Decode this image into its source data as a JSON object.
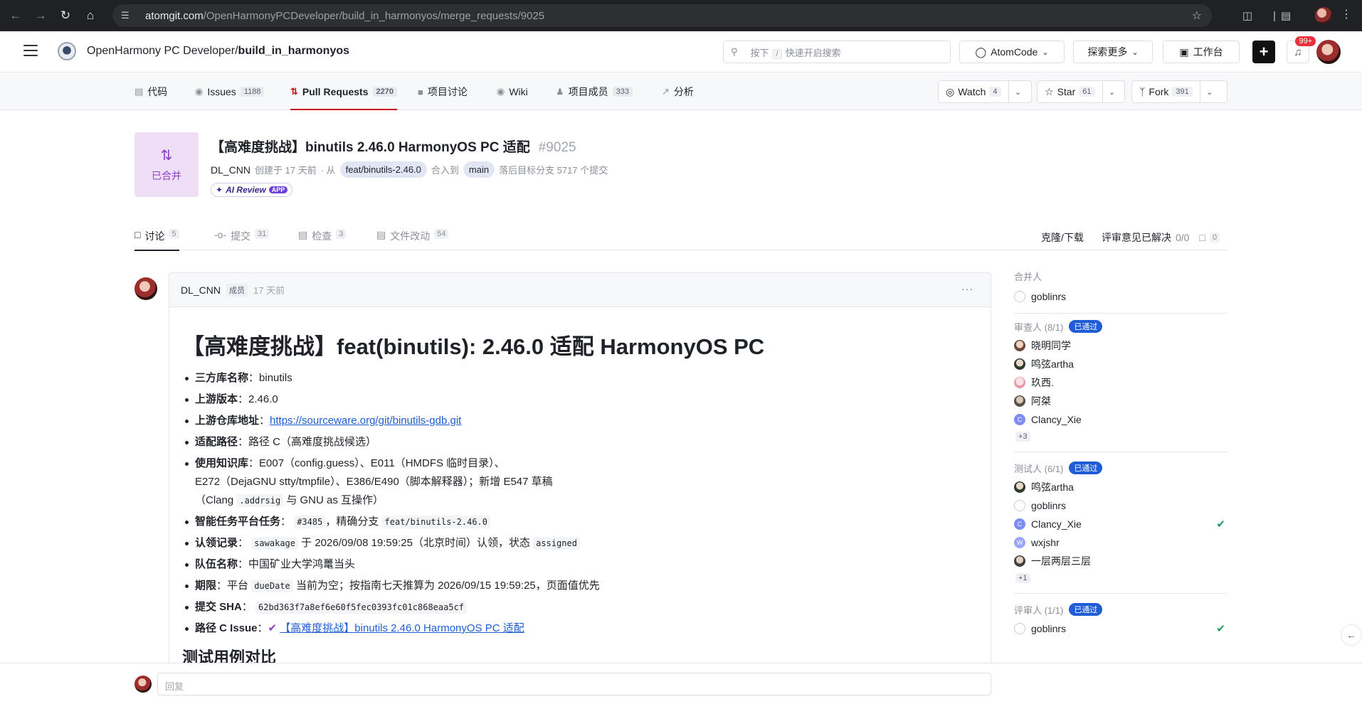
{
  "browser": {
    "url_host": "atomgit.com",
    "url_path": "/OpenHarmonyPCDeveloper/build_in_harmonyos/merge_requests/9025"
  },
  "header": {
    "breadcrumb_org": "OpenHarmony PC Developer/",
    "breadcrumb_repo": "build_in_harmonyos",
    "search_prefix": "按下",
    "search_key": "/",
    "search_suffix": "快速开启搜索",
    "atomcode_label": "AtomCode",
    "explore_label": "探索更多",
    "workbench_label": "工作台",
    "notif_badge": "99+"
  },
  "projnav": {
    "items": [
      {
        "label": "代码",
        "count": ""
      },
      {
        "label": "Issues",
        "count": "1188"
      },
      {
        "label": "Pull Requests",
        "count": "2270"
      },
      {
        "label": "项目讨论",
        "count": ""
      },
      {
        "label": "Wiki",
        "count": ""
      },
      {
        "label": "项目成员",
        "count": "333"
      },
      {
        "label": "分析",
        "count": ""
      }
    ],
    "watch": {
      "label": "Watch",
      "count": "4"
    },
    "star": {
      "label": "Star",
      "count": "61"
    },
    "fork": {
      "label": "Fork",
      "count": "391"
    }
  },
  "mr": {
    "state": "已合并",
    "title": "【高难度挑战】binutils 2.46.0 HarmonyOS PC 适配",
    "number": "#9025",
    "author": "DL_CNN",
    "created": "创建于 17 天前",
    "from_label": "· 从",
    "source_branch": "feat/binutils-2.46.0",
    "into_label": "合入到",
    "target_branch": "main",
    "behind_text": "落后目标分支 5717 个提交",
    "ai_review": "AI Review",
    "ai_app": "APP"
  },
  "tabs": {
    "items": [
      {
        "label": "讨论",
        "count": "5"
      },
      {
        "label": "提交",
        "count": "31"
      },
      {
        "label": "检查",
        "count": "3"
      },
      {
        "label": "文件改动",
        "count": "54"
      }
    ],
    "clone_label": "克隆/下载",
    "resolved_label": "评审意见已解决",
    "resolved_count": "0/0",
    "comments_count": "0"
  },
  "comment": {
    "author": "DL_CNN",
    "role": "成员",
    "time": "17 天前",
    "heading": "【高难度挑战】feat(binutils): 2.46.0 适配 HarmonyOS PC",
    "items": {
      "lib_k": "三方库名称",
      "lib_v": "：binutils",
      "ver_k": "上游版本",
      "ver_v": "：2.46.0",
      "repo_k": "上游仓库地址",
      "repo_sep": "：",
      "repo_link": "https://sourceware.org/git/binutils-gdb.git",
      "path_k": "适配路径",
      "path_v": "：路径 C（高难度挑战候选）",
      "kb_k": "使用知识库",
      "kb_v1": "：E007（config.guess）、E011（HMDFS 临时目录）、",
      "kb_v2": "E272（DejaGNU stty/tmpfile）、E386/E490（脚本解释器）；新增 E547 草稿",
      "kb_v3a": "（Clang",
      "kb_code": ".addrsig",
      "kb_v3b": "与 GNU as 互操作）",
      "task_k": "智能任务平台任务",
      "task_sep": "：",
      "task_code": "#3485",
      "task_mid": "，精确分支",
      "task_branch": "feat/binutils-2.46.0",
      "claim_k": "认领记录",
      "claim_sep": "：",
      "claim_user": "sawakage",
      "claim_mid": "于 2026/09/08 19:59:25（北京时间）认领，状态",
      "claim_state": "assigned",
      "team_k": "队伍名称",
      "team_v": "：中国矿业大学鸿鼍当头",
      "due_k": "期限",
      "due_a": "：平台",
      "due_code": "dueDate",
      "due_b": "当前为空；按指南七天推算为 2026/09/15 19:59:25，页面值优先",
      "sha_k": "提交 SHA",
      "sha_sep": "：",
      "sha_code": "62bd363f7a8ef6e60f5fec0393fc01c868eaa5cf",
      "issue_k": "路径 C Issue",
      "issue_sep": "：",
      "issue_link": "【高难度挑战】binutils 2.46.0 HarmonyOS PC 适配"
    },
    "next_heading": "测试用例对比"
  },
  "sidebar": {
    "merger_title": "合并人",
    "merger": "goblinrs",
    "reviewers_title": "审查人 (8/1)",
    "reviewers_status": "已通过",
    "reviewers": [
      "晓明同学",
      "鸣弦artha",
      "玖西.",
      "阿桀",
      "Clancy_Xie"
    ],
    "reviewers_more": "+3",
    "testers_title": "测试人 (6/1)",
    "testers_status": "已通过",
    "testers": [
      "鸣弦artha",
      "goblinrs",
      "Clancy_Xie",
      "wxjshr",
      "一层两层三层"
    ],
    "testers_more": "+1",
    "approvers_title": "评审人 (1/1)",
    "approvers_status": "已通过",
    "approvers": [
      "goblinrs"
    ],
    "avatar_letters": {
      "c": "C",
      "w": "W"
    }
  },
  "reply": {
    "placeholder": "回复"
  },
  "colors": {
    "accent": "#c7000b",
    "merged_bg": "#eedff6",
    "merged_fg": "#8e3ec7",
    "pass_badge": "#1f5cd6",
    "check": "#14a05a"
  }
}
